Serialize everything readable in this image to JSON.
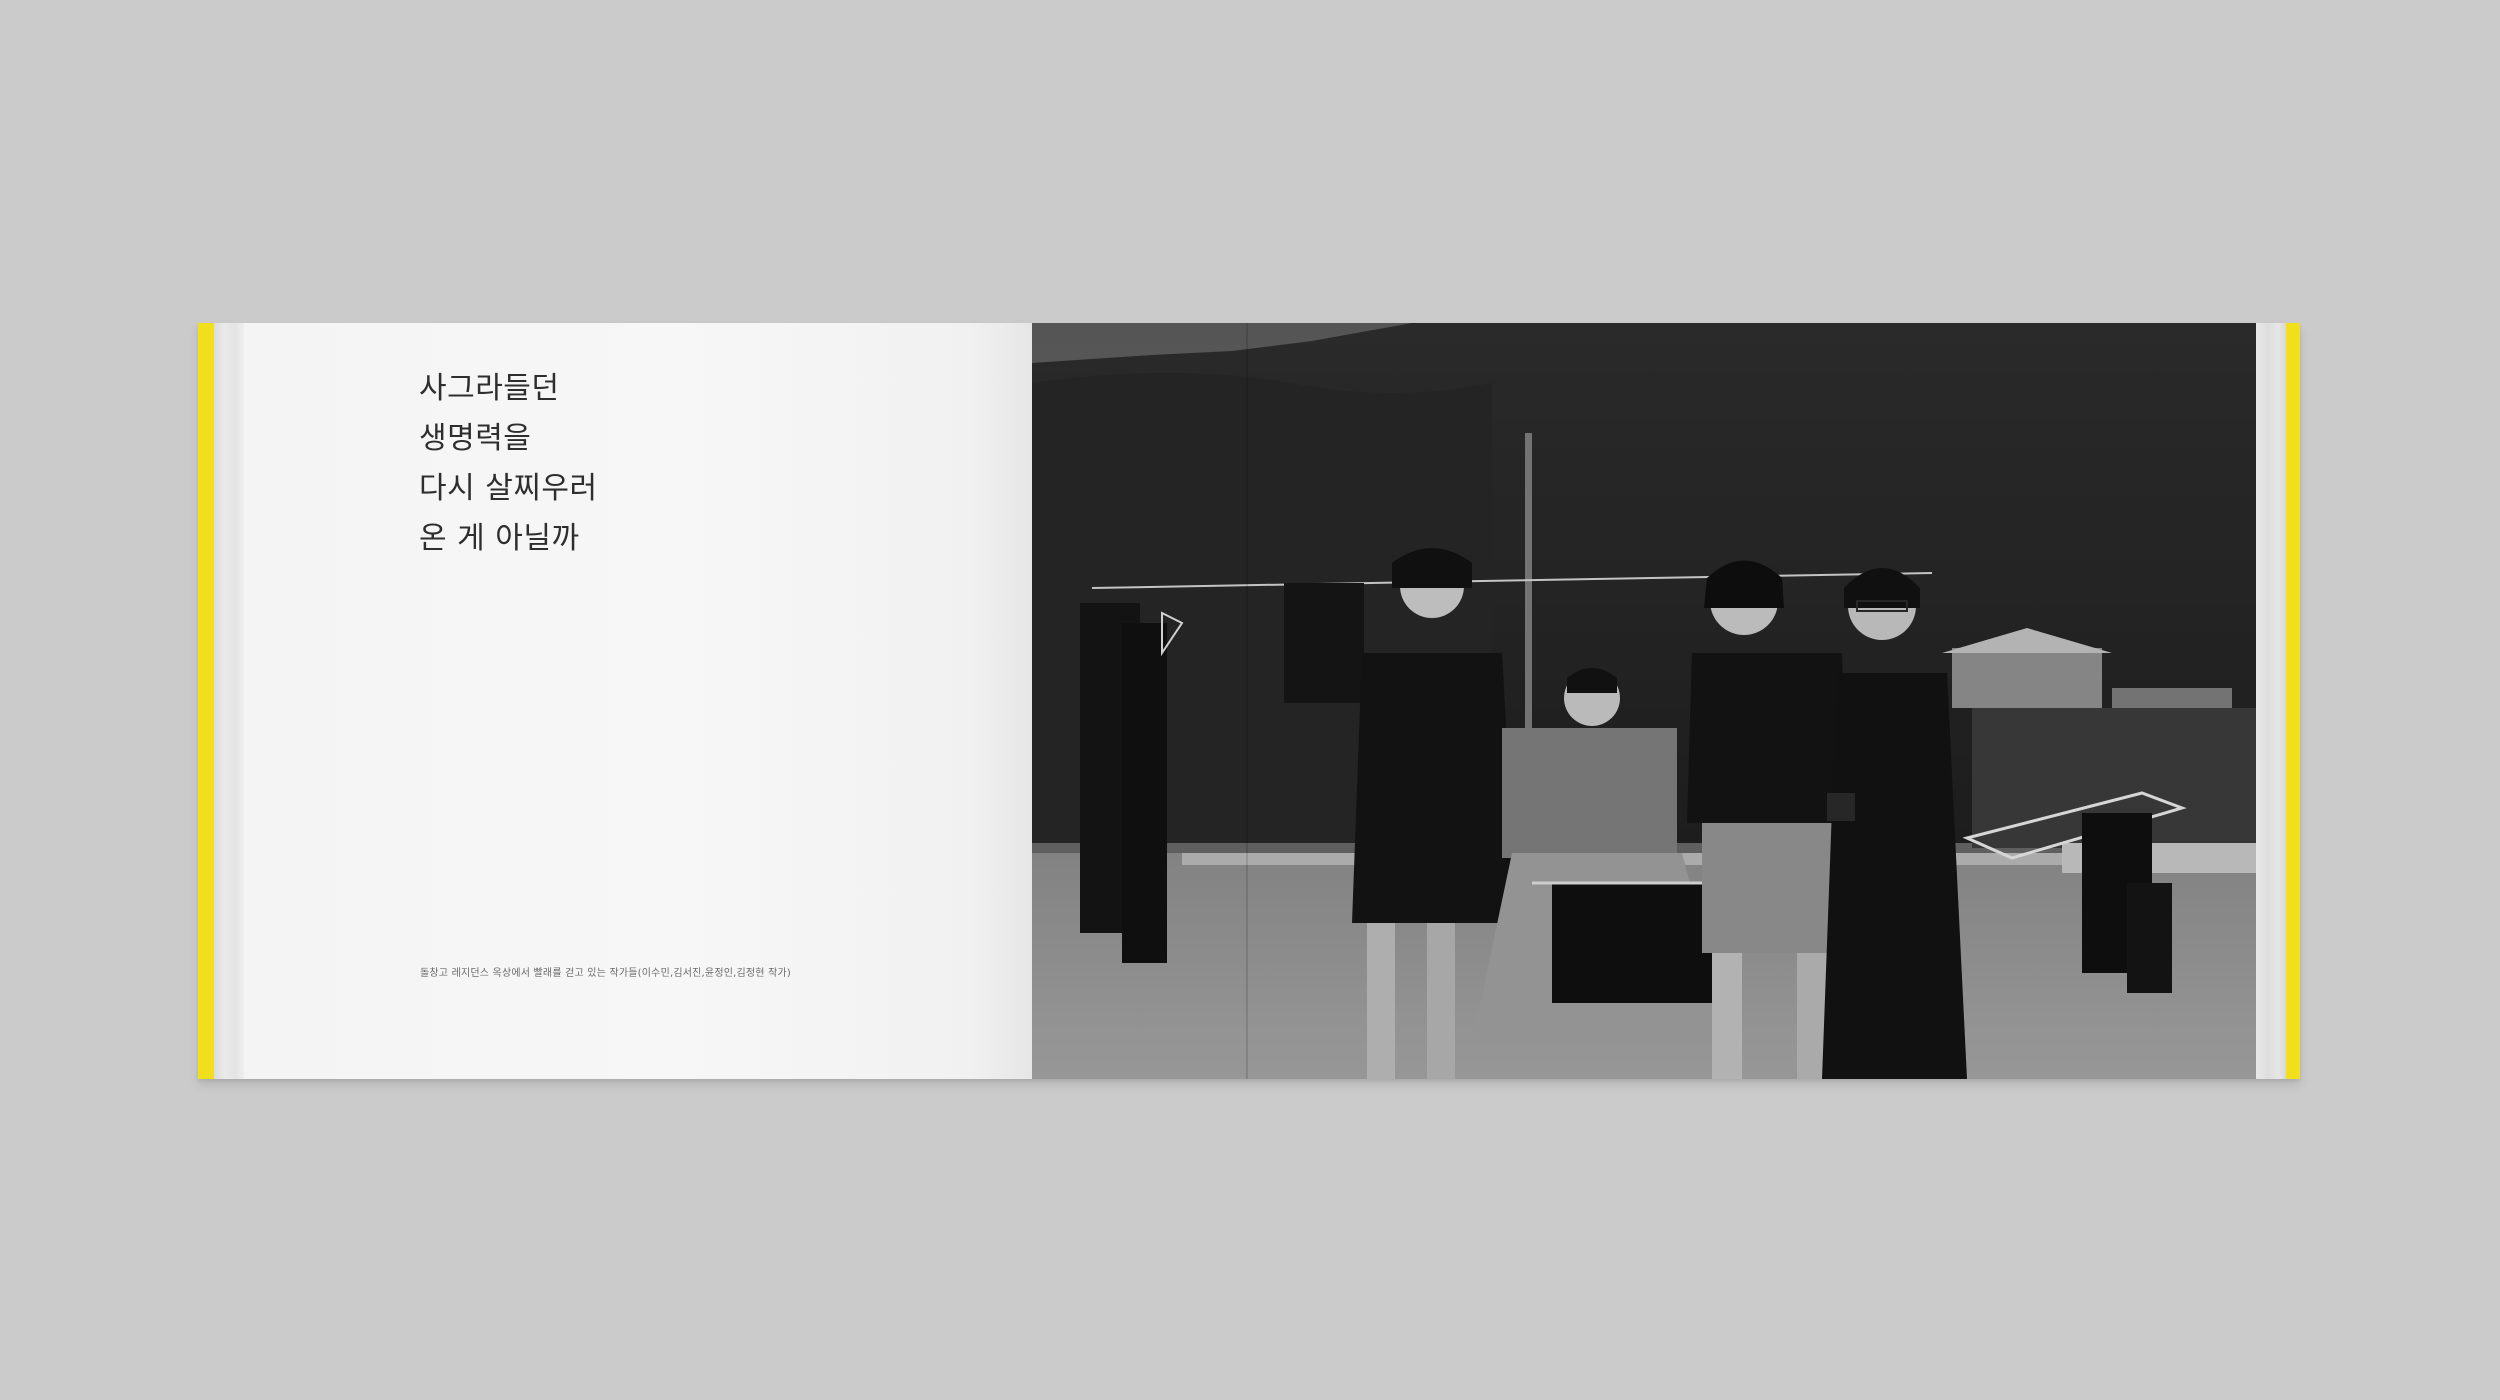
{
  "spread": {
    "accent_color": "#f0df1a",
    "left_page": {
      "quote_lines": [
        "사그라들던",
        "생명력을",
        "다시 살찌우러",
        "온 게 아닐까"
      ],
      "caption": "돌창고 레지던스 옥상에서 빨래를 걷고 있는 작가들(이수민,김서진,윤정인,김정현 작가)"
    },
    "right_page": {
      "photo": "black-and-white photo of four people on a rooftop with laundry, mountains behind"
    }
  }
}
